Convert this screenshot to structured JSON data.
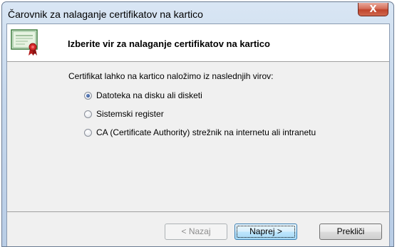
{
  "window": {
    "title": "Čarovnik za nalaganje certifikatov na kartico",
    "close_label": "X"
  },
  "header": {
    "title": "Izberite vir za nalaganje certifikatov na kartico",
    "icon": "certificate-icon"
  },
  "body": {
    "description": "Certifikat lahko na kartico naložimo iz naslednjih virov:",
    "options": [
      {
        "label": "Datoteka na disku ali disketi",
        "checked": true
      },
      {
        "label": "Sistemski register",
        "checked": false
      },
      {
        "label": "CA (Certificate Authority) strežnik na internetu ali intranetu",
        "checked": false
      }
    ]
  },
  "buttons": {
    "back_label": "< Nazaj",
    "next_label": "Naprej >",
    "cancel_label": "Prekliči",
    "back_enabled": false
  },
  "colors": {
    "accent": "#3c7fb1",
    "close": "#c0442c"
  }
}
